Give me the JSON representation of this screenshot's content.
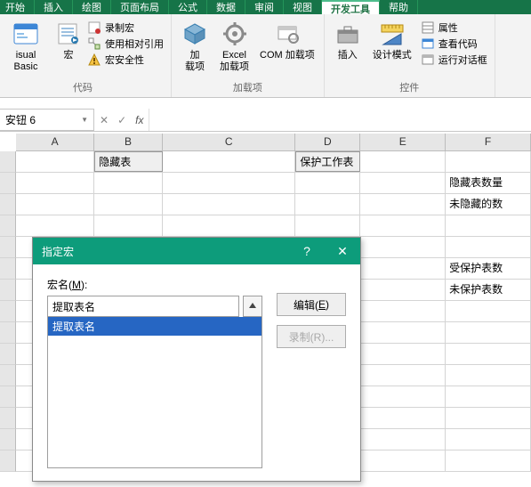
{
  "tabs": [
    "开始",
    "插入",
    "绘图",
    "页面布局",
    "公式",
    "数据",
    "审阅",
    "视图",
    "开发工具",
    "帮助"
  ],
  "ribbon": {
    "vb": "isual Basic",
    "macro": "宏",
    "record": "录制宏",
    "relative": "使用相对引用",
    "safety": "宏安全性",
    "group_code": "代码",
    "addin": "加\n载项",
    "excel_addin": "Excel\n加载项",
    "com_addin": "COM 加载项",
    "group_addin": "加载项",
    "insert": "插入",
    "design": "设计模式",
    "props": "属性",
    "viewcode": "查看代码",
    "rundlg": "运行对话框",
    "group_ctrl": "控件"
  },
  "name_box": "安钮 6",
  "fx": "fx",
  "columns": [
    "A",
    "B",
    "C",
    "D",
    "E",
    "F"
  ],
  "cells": {
    "b1": "隐藏表",
    "d1": "保护工作表",
    "f2": "隐藏表数量",
    "f3": "未隐藏的数",
    "f6": "受保护表数",
    "f7": "未保护表数"
  },
  "dialog": {
    "title": "指定宏",
    "label": "宏名(<u>M</u>):",
    "input": "提取表名",
    "item": "提取表名",
    "edit": "编辑(<u>E</u>)",
    "rec": "录制(R)..."
  }
}
